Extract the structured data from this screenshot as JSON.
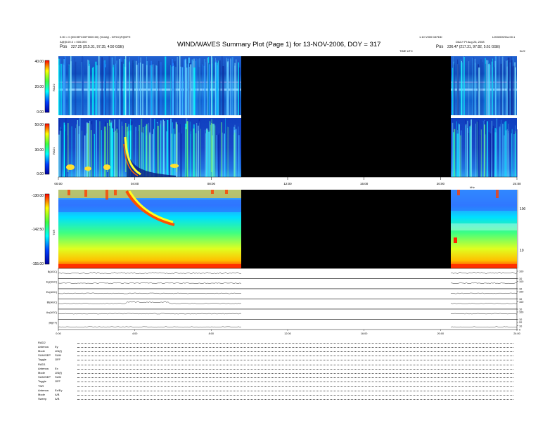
{
  "header": {
    "title": "WIND/WAVES Summary Plot (Page 1) for 13-NOV-2006, DOY = 317",
    "left_line1": "0.00 = 0 (000 BFC00F0000:00) (Yearly) - 0/FDC)F@0FE",
    "left_line2": "A@[0.00.0 = 000.0E0",
    "left_pos_label": "Pos",
    "left_pos_value": "227.25 (215.31, 97.35, 4.50 GSE)",
    "right_top": "1.10 V000 D4FDD",
    "right_top2": "L003/000/0/a.00.1",
    "right_line2": "DAILY Pl Aug 26, 2008",
    "right_pos_label": "Pos",
    "right_pos_value": "236.47 (217.31, 97.82, 5.61 GSE)",
    "right_edge": "0n/2",
    "time_label": "TIME UTC"
  },
  "panels": {
    "rad2": {
      "label": "RAD2",
      "ticks": [
        "40.00",
        "20.00",
        "0.00"
      ]
    },
    "rad1": {
      "label": "RAD1",
      "ticks": [
        "50.00",
        "30.00",
        "0.00"
      ]
    },
    "tnr": {
      "label": "TNR",
      "ticks": [
        "-130.00",
        "-142.50",
        "-155.00"
      ],
      "right_ticks": [
        "100",
        "10"
      ],
      "right_axis_label": "kHz"
    },
    "xticks_mid": [
      "00:00",
      "04:00",
      "08:00",
      "12:00",
      "16:00",
      "20:00",
      "24:00"
    ],
    "xticks_bottom": [
      "0:00",
      "4:00",
      "8:00",
      "12:00",
      "16:00",
      "20:00",
      "24:00"
    ]
  },
  "line_panels": [
    {
      "label": "B(AGC)",
      "right": [
        "100",
        "10"
      ]
    },
    {
      "label": "Ey(AGC)",
      "right": [
        "100",
        "10"
      ]
    },
    {
      "label": "Ez(AGC)",
      "right": [
        "100",
        "10"
      ]
    },
    {
      "label": "Bt(AGC)",
      "right": [
        "100",
        "10"
      ]
    },
    {
      "label": "Ax(AGC)",
      "right": [
        "100",
        "10"
      ]
    },
    {
      "label": "|B|(nT)",
      "right": [
        "20",
        "10",
        "0"
      ]
    }
  ],
  "info_block": {
    "rad2_header": "RAD2",
    "rad2_rows": [
      {
        "label": "Antenna",
        "value": "Ey"
      },
      {
        "label": "Mode",
        "value": "LIN(f)"
      },
      {
        "label": "SUM/SEP",
        "value": "SUM"
      },
      {
        "label": "Toggle",
        "value": "OFF"
      }
    ],
    "rad1_header": "RAD1",
    "rad1_rows": [
      {
        "label": "Antenna",
        "value": "Ex"
      },
      {
        "label": "Mode",
        "value": "LIN(f)"
      },
      {
        "label": "SUM/SEP",
        "value": "SUM"
      },
      {
        "label": "Toggle",
        "value": "OFF"
      }
    ],
    "tnr_header": "TNR",
    "tnr_rows": [
      {
        "label": "Antenna",
        "value": "Ex/Ey"
      },
      {
        "label": "Mode",
        "value": "A/B"
      },
      {
        "label": "Sweep",
        "value": "A/B"
      }
    ]
  },
  "colors": {
    "bg": "#000080",
    "gap": "#000000",
    "hot": "#ff0000",
    "warm": "#ffff00",
    "mid": "#00ffff"
  },
  "chart_data": {
    "type": "heatmap",
    "title": "WIND/WAVES Summary Plot (Page 1) for 13-NOV-2006, DOY = 317",
    "xlabel": "TIME UTC",
    "x_range_hours": [
      0,
      24
    ],
    "data_gap_hours": [
      10.2,
      20.6
    ],
    "panels": [
      "RAD2",
      "RAD1",
      "TNR",
      "B(AGC)",
      "Ey(AGC)",
      "Ez(AGC)",
      "Bt(AGC)",
      "Ax(AGC)",
      "|B|(nT)"
    ],
    "colorbar_ranges": {
      "RAD2": [
        0,
        40
      ],
      "RAD1": [
        0,
        50
      ],
      "TNR": [
        -155,
        -130
      ]
    },
    "events": [
      {
        "panel": "RAD1",
        "type": "type III burst",
        "start_hour": 3.9,
        "end_hour": 5.8
      },
      {
        "panel": "TNR",
        "type": "type III burst",
        "start_hour": 3.9,
        "end_hour": 6.0
      }
    ]
  }
}
